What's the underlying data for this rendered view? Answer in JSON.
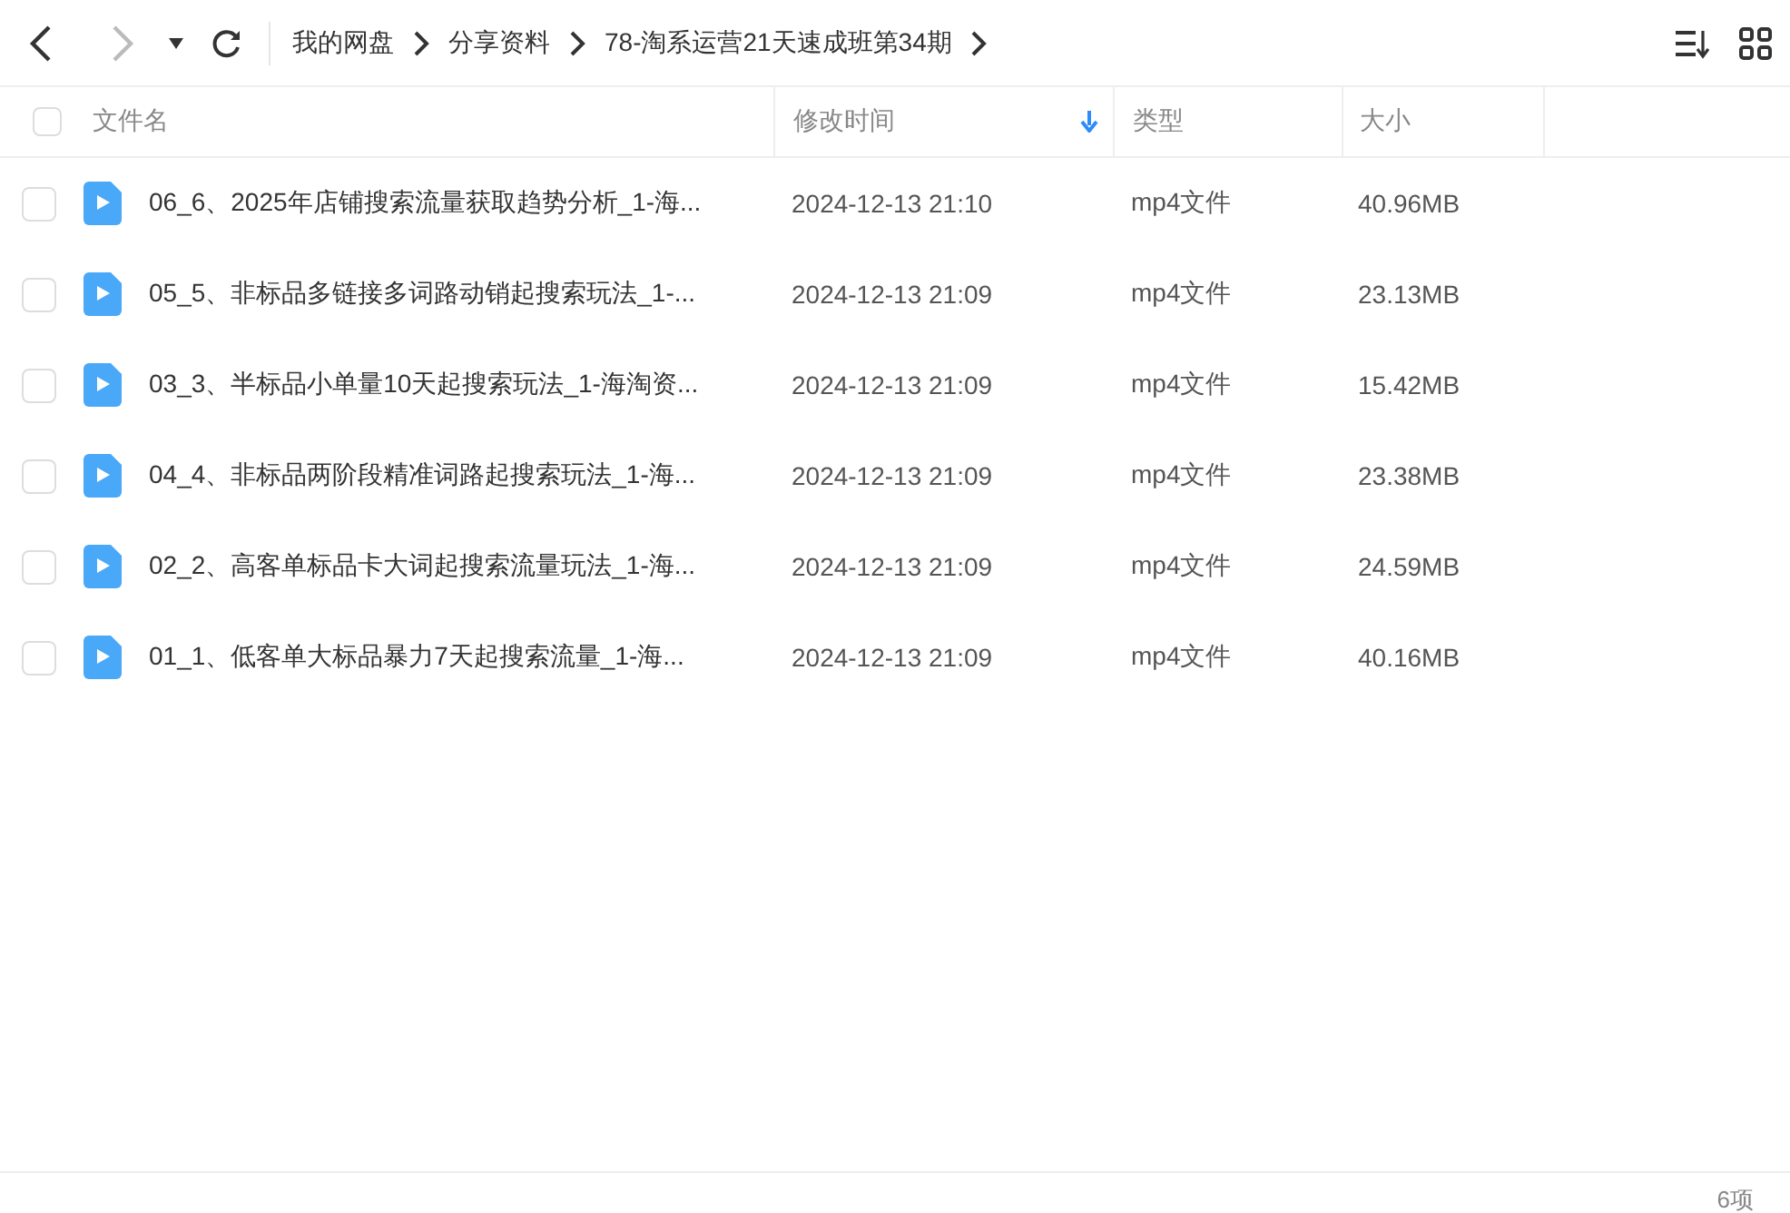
{
  "toolbar": {
    "breadcrumbs": [
      "我的网盘",
      "分享资料",
      "78-淘系运营21天速成班第34期"
    ]
  },
  "table": {
    "columns": [
      {
        "label": "文件名",
        "sorted": false
      },
      {
        "label": "修改时间",
        "sorted": true
      },
      {
        "label": "类型",
        "sorted": false
      },
      {
        "label": "大小",
        "sorted": false
      }
    ],
    "header_checked": false,
    "rows": [
      {
        "name": "06_6、2025年店铺搜索流量获取趋势分析_1-海...",
        "modified": "2024-12-13 21:10",
        "type": "mp4文件",
        "size": "40.96MB",
        "checked": false
      },
      {
        "name": "05_5、非标品多链接多词路动销起搜索玩法_1-...",
        "modified": "2024-12-13 21:09",
        "type": "mp4文件",
        "size": "23.13MB",
        "checked": false
      },
      {
        "name": "03_3、半标品小单量10天起搜索玩法_1-海淘资...",
        "modified": "2024-12-13 21:09",
        "type": "mp4文件",
        "size": "15.42MB",
        "checked": false
      },
      {
        "name": "04_4、非标品两阶段精准词路起搜索玩法_1-海...",
        "modified": "2024-12-13 21:09",
        "type": "mp4文件",
        "size": "23.38MB",
        "checked": false
      },
      {
        "name": "02_2、高客单标品卡大词起搜索流量玩法_1-海...",
        "modified": "2024-12-13 21:09",
        "type": "mp4文件",
        "size": "24.59MB",
        "checked": false
      },
      {
        "name": "01_1、低客单大标品暴力7天起搜索流量_1-海...",
        "modified": "2024-12-13 21:09",
        "type": "mp4文件",
        "size": "40.16MB",
        "checked": false
      }
    ]
  },
  "status_bar": {
    "count": "6项"
  }
}
